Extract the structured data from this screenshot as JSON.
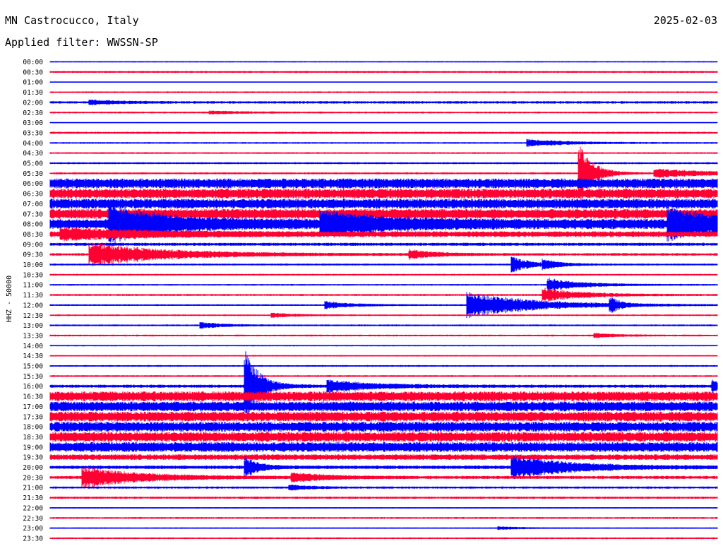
{
  "header": {
    "station": "MN Castrocucco, Italy",
    "date": "2025-02-03",
    "filter": "Applied filter: WWSSN-SP"
  },
  "chart_data": {
    "type": "line",
    "title": "MN Castrocucco, Italy",
    "subtitle": "Applied filter: WWSSN-SP",
    "date": "2025-02-03",
    "ylabel": "HHZ - 50000",
    "xlabel": "",
    "row_interval_minutes": 30,
    "colors": [
      "#0000ff",
      "#ff0033"
    ],
    "row_labels": [
      "00:00",
      "00:30",
      "01:00",
      "01:30",
      "02:00",
      "02:30",
      "03:00",
      "03:30",
      "04:00",
      "04:30",
      "05:00",
      "05:30",
      "06:00",
      "06:30",
      "07:00",
      "07:30",
      "08:00",
      "08:30",
      "09:00",
      "09:30",
      "10:00",
      "10:30",
      "11:00",
      "11:30",
      "12:00",
      "12:30",
      "13:00",
      "13:30",
      "14:00",
      "14:30",
      "15:00",
      "15:30",
      "16:00",
      "16:30",
      "17:00",
      "17:30",
      "18:00",
      "18:30",
      "19:00",
      "19:30",
      "20:00",
      "20:30",
      "21:00",
      "21:30",
      "22:00",
      "22:30",
      "23:00",
      "23:30"
    ],
    "noise_levels": [
      0.8,
      1.4,
      0.7,
      1.2,
      1.8,
      1.3,
      0.6,
      1.5,
      1.2,
      1.2,
      1.4,
      1.4,
      7,
      7,
      7,
      7,
      7,
      4,
      2.2,
      1.8,
      1.4,
      1.3,
      1.2,
      1.4,
      1.2,
      1.2,
      1.3,
      1.3,
      0.9,
      1,
      1.2,
      1.3,
      2.2,
      7,
      7,
      7,
      7,
      7,
      7,
      4,
      2.5,
      2.2,
      1.6,
      1.6,
      0.9,
      1.3,
      1,
      1.3
    ],
    "events": [
      {
        "row": "02:00",
        "minute": 1.8,
        "amplitude": 3,
        "duration_min": 1.2
      },
      {
        "row": "02:30",
        "minute": 7.2,
        "amplitude": 2,
        "duration_min": 1.5
      },
      {
        "row": "04:00",
        "minute": 21.5,
        "amplitude": 5,
        "duration_min": 1.8
      },
      {
        "row": "05:30",
        "minute": 23.8,
        "amplitude": 42,
        "duration_min": 0.6
      },
      {
        "row": "05:30",
        "minute": 27.2,
        "amplitude": 6,
        "duration_min": 2.5
      },
      {
        "row": "08:00",
        "minute": 2.7,
        "amplitude": 22,
        "duration_min": 2.5
      },
      {
        "row": "08:00",
        "minute": 12.2,
        "amplitude": 14,
        "duration_min": 3
      },
      {
        "row": "08:00",
        "minute": 27.8,
        "amplitude": 20,
        "duration_min": 2.5
      },
      {
        "row": "08:30",
        "minute": 0.5,
        "amplitude": 7,
        "duration_min": 4
      },
      {
        "row": "09:30",
        "minute": 1.8,
        "amplitude": 16,
        "duration_min": 3.5
      },
      {
        "row": "09:30",
        "minute": 16.2,
        "amplitude": 6,
        "duration_min": 1.2
      },
      {
        "row": "10:00",
        "minute": 20.8,
        "amplitude": 11,
        "duration_min": 0.8
      },
      {
        "row": "10:00",
        "minute": 22.2,
        "amplitude": 6,
        "duration_min": 0.7
      },
      {
        "row": "11:00",
        "minute": 22.4,
        "amplitude": 9,
        "duration_min": 1.5
      },
      {
        "row": "11:30",
        "minute": 22.2,
        "amplitude": 9,
        "duration_min": 1.8
      },
      {
        "row": "12:00",
        "minute": 12.4,
        "amplitude": 5,
        "duration_min": 1.2
      },
      {
        "row": "12:00",
        "minute": 18.8,
        "amplitude": 18,
        "duration_min": 3
      },
      {
        "row": "12:00",
        "minute": 25.2,
        "amplitude": 11,
        "duration_min": 0.4
      },
      {
        "row": "12:30",
        "minute": 10,
        "amplitude": 3,
        "duration_min": 1
      },
      {
        "row": "13:00",
        "minute": 6.8,
        "amplitude": 4,
        "duration_min": 1
      },
      {
        "row": "13:30",
        "minute": 24.5,
        "amplitude": 3,
        "duration_min": 1
      },
      {
        "row": "16:00",
        "minute": 8.8,
        "amplitude": 50,
        "duration_min": 0.6
      },
      {
        "row": "16:00",
        "minute": 12.5,
        "amplitude": 8,
        "duration_min": 2
      },
      {
        "row": "16:00",
        "minute": 29.8,
        "amplitude": 9,
        "duration_min": 0.5
      },
      {
        "row": "20:00",
        "minute": 8.8,
        "amplitude": 14,
        "duration_min": 0.6
      },
      {
        "row": "20:00",
        "minute": 20.8,
        "amplitude": 16,
        "duration_min": 2.5
      },
      {
        "row": "20:30",
        "minute": 1.5,
        "amplitude": 14,
        "duration_min": 2.5
      },
      {
        "row": "20:30",
        "minute": 10.9,
        "amplitude": 6,
        "duration_min": 1.5
      },
      {
        "row": "21:00",
        "minute": 10.8,
        "amplitude": 4,
        "duration_min": 0.8
      },
      {
        "row": "23:00",
        "minute": 20.2,
        "amplitude": 2,
        "duration_min": 1
      }
    ]
  }
}
